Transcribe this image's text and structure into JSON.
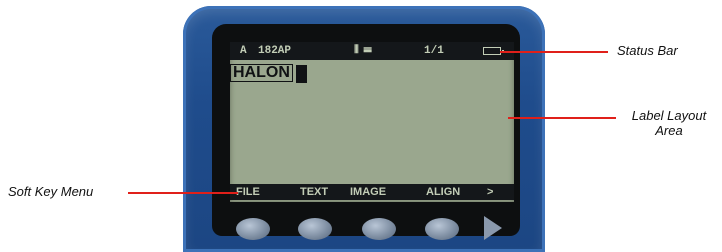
{
  "status_bar": {
    "mode": "A",
    "font": "182AP",
    "justify_glyph": "⦀ ☰",
    "page": "1/1",
    "battery_icon": "battery-icon"
  },
  "label": {
    "text": "HALON"
  },
  "soft_keys": [
    {
      "label": "FILE"
    },
    {
      "label": "TEXT"
    },
    {
      "label": "IMAGE"
    },
    {
      "label": "ALIGN"
    },
    {
      "label": ">"
    }
  ],
  "callouts": {
    "status_bar": "Status Bar",
    "layout_area": "Label Layout Area",
    "soft_key_menu": "Soft Key Menu"
  },
  "colors": {
    "lcd": "#9aa78e",
    "bar": "#14171a",
    "bezel": "#1f4c8c",
    "callout": "#e0201a"
  }
}
